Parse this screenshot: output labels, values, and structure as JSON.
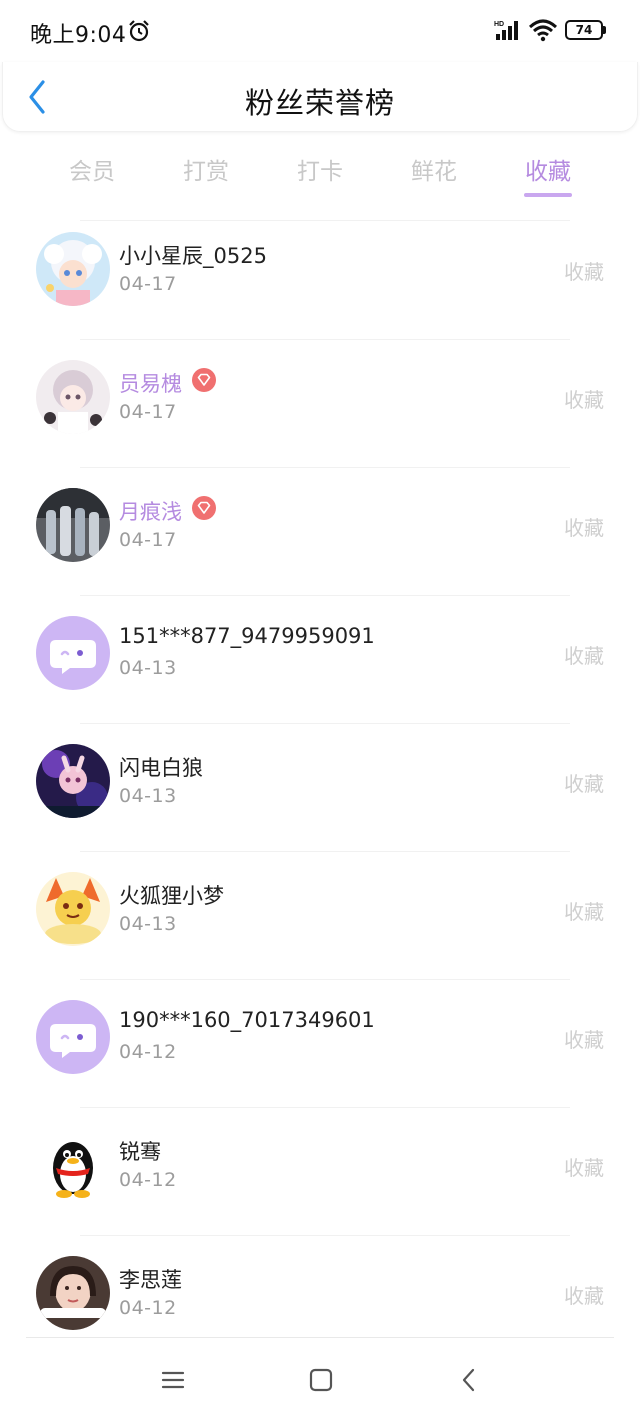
{
  "status_bar": {
    "time": "晚上9:04",
    "battery": "74",
    "icons": [
      "alarm-icon",
      "hd-signal-icon",
      "wifi-icon",
      "battery-icon"
    ]
  },
  "header": {
    "title": "粉丝荣誉榜",
    "back_icon": "chevron-left-icon"
  },
  "tabs": [
    {
      "label": "会员",
      "active": false
    },
    {
      "label": "打赏",
      "active": false
    },
    {
      "label": "打卡",
      "active": false
    },
    {
      "label": "鲜花",
      "active": false
    },
    {
      "label": "收藏",
      "active": true
    }
  ],
  "fans": [
    {
      "name": "小小星辰_0525",
      "date": "04-17",
      "action": "收藏",
      "vip": false,
      "avatar": "anime-girl-avatar"
    },
    {
      "name": "员易槐",
      "date": "04-17",
      "action": "收藏",
      "vip": true,
      "avatar": "anime-girl-avatar"
    },
    {
      "name": "月痕浅",
      "date": "04-17",
      "action": "收藏",
      "vip": true,
      "avatar": "group-photo-avatar"
    },
    {
      "name": "151***877_9479959091",
      "date": "04-13",
      "action": "收藏",
      "vip": false,
      "avatar": "default-chat-avatar"
    },
    {
      "name": "闪电白狼",
      "date": "04-13",
      "action": "收藏",
      "vip": false,
      "avatar": "game-character-avatar"
    },
    {
      "name": "火狐狸小梦",
      "date": "04-13",
      "action": "收藏",
      "vip": false,
      "avatar": "fox-avatar"
    },
    {
      "name": "190***160_7017349601",
      "date": "04-12",
      "action": "收藏",
      "vip": false,
      "avatar": "default-chat-avatar"
    },
    {
      "name": "锐骞",
      "date": "04-12",
      "action": "收藏",
      "vip": false,
      "avatar": "penguin-avatar"
    },
    {
      "name": "李思莲",
      "date": "04-12",
      "action": "收藏",
      "vip": false,
      "avatar": "portrait-photo-avatar"
    }
  ],
  "colors": {
    "accent": "#b58be0",
    "tab_indicator": "#c9a7ef",
    "vip_badge": "#f07070",
    "default_avatar_bg": "#cdb6f4"
  },
  "nav_bar": {
    "icons": [
      "menu-icon",
      "home-square-icon",
      "back-arrow-icon"
    ]
  }
}
